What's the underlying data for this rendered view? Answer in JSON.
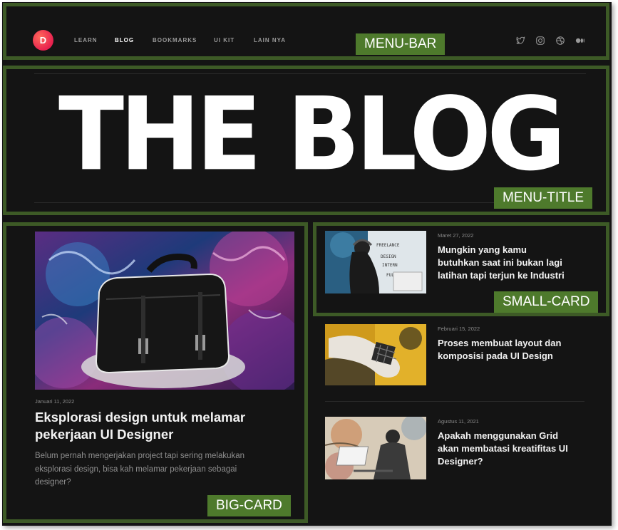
{
  "nav": {
    "logo_letter": "D",
    "links": [
      "LEARN",
      "BLOG",
      "BOOKMARKS",
      "UI KIT",
      "LAIN NYA"
    ],
    "active": "BLOG",
    "social_icons": [
      "twitter-icon",
      "instagram-icon",
      "dribbble-icon",
      "medium-icon"
    ]
  },
  "hero": {
    "title": "THE BLOG"
  },
  "featured": {
    "date": "Januari 11, 2022",
    "title_line1": "Eksplorasi design untuk melamar",
    "title_line2": "pekerjaan UI Designer",
    "desc_line1": "Belum pernah mengerjakan project tapi sering melakukan",
    "desc_line2": "eksplorasi design, bisa kah melamar pekerjaan sebagai",
    "desc_line3": "designer?"
  },
  "posts": [
    {
      "date": "Maret 27, 2022",
      "title_line1": "Mungkin yang kamu",
      "title_line2": "butuhkan saat ini bukan lagi",
      "title_line3": "latihan tapi terjun ke Industri"
    },
    {
      "date": "Februari 15, 2022",
      "title_line1": "Proses membuat layout dan",
      "title_line2": "komposisi pada UI Design"
    },
    {
      "date": "Agustus 11, 2021",
      "title_line1": "Apakah menggunakan Grid",
      "title_line2": "akan membatasi kreatifitas UI",
      "title_line3": "Designer?"
    }
  ],
  "annotations": {
    "menu_bar": "MENU-BAR",
    "menu_title": "MENU-TITLE",
    "small_card": "SMALL-CARD",
    "big_card": "BIG-CARD"
  },
  "colors": {
    "background": "#141414",
    "frame": "#3d5a26",
    "tag": "#4e7a2c",
    "accent": "#e8214f"
  }
}
